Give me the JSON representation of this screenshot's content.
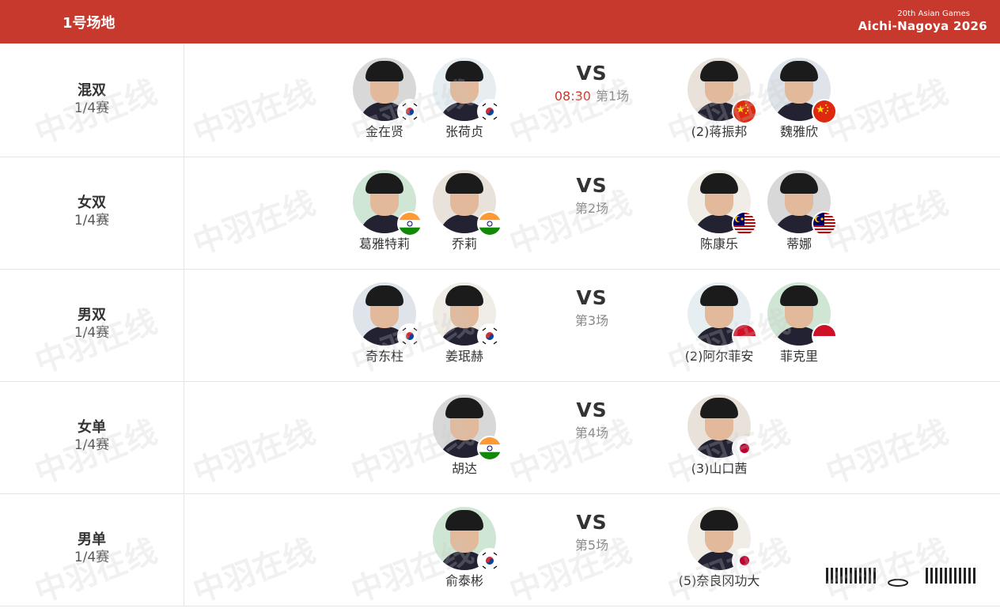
{
  "header": {
    "court": "1号场地",
    "games_small": "20th Asian Games",
    "games_big": "Aichi-Nagoya 2026"
  },
  "watermark": "中羽在线",
  "matches": [
    {
      "event": "混双",
      "round": "1/4赛",
      "vs": "VS",
      "time": "08:30",
      "match_no": "第1场",
      "left": [
        {
          "name": "金在贤",
          "flag": "korea"
        },
        {
          "name": "张荷贞",
          "flag": "korea"
        }
      ],
      "right": [
        {
          "name": "(2)蒋振邦",
          "flag": "china"
        },
        {
          "name": "魏雅欣",
          "flag": "china"
        }
      ]
    },
    {
      "event": "女双",
      "round": "1/4赛",
      "vs": "VS",
      "time": "",
      "match_no": "第2场",
      "left": [
        {
          "name": "葛雅特莉",
          "flag": "india"
        },
        {
          "name": "乔莉",
          "flag": "india"
        }
      ],
      "right": [
        {
          "name": "陈康乐",
          "flag": "malaysia"
        },
        {
          "name": "蒂娜",
          "flag": "malaysia"
        }
      ]
    },
    {
      "event": "男双",
      "round": "1/4赛",
      "vs": "VS",
      "time": "",
      "match_no": "第3场",
      "left": [
        {
          "name": "奇东柱",
          "flag": "korea"
        },
        {
          "name": "姜珉赫",
          "flag": "korea"
        }
      ],
      "right": [
        {
          "name": "(2)阿尔菲安",
          "flag": "indonesia"
        },
        {
          "name": "菲克里",
          "flag": "indonesia"
        }
      ]
    },
    {
      "event": "女单",
      "round": "1/4赛",
      "vs": "VS",
      "time": "",
      "match_no": "第4场",
      "left": [
        {
          "name": "胡达",
          "flag": "india"
        }
      ],
      "right": [
        {
          "name": "(3)山口茜",
          "flag": "japan"
        }
      ]
    },
    {
      "event": "男单",
      "round": "1/4赛",
      "vs": "VS",
      "time": "",
      "match_no": "第5场",
      "left": [
        {
          "name": "俞泰彬",
          "flag": "korea"
        }
      ],
      "right": [
        {
          "name": "(5)奈良冈功大",
          "flag": "japan"
        }
      ]
    }
  ],
  "colors": {
    "header_bg": "#c8392d",
    "time": "#c8392d"
  }
}
